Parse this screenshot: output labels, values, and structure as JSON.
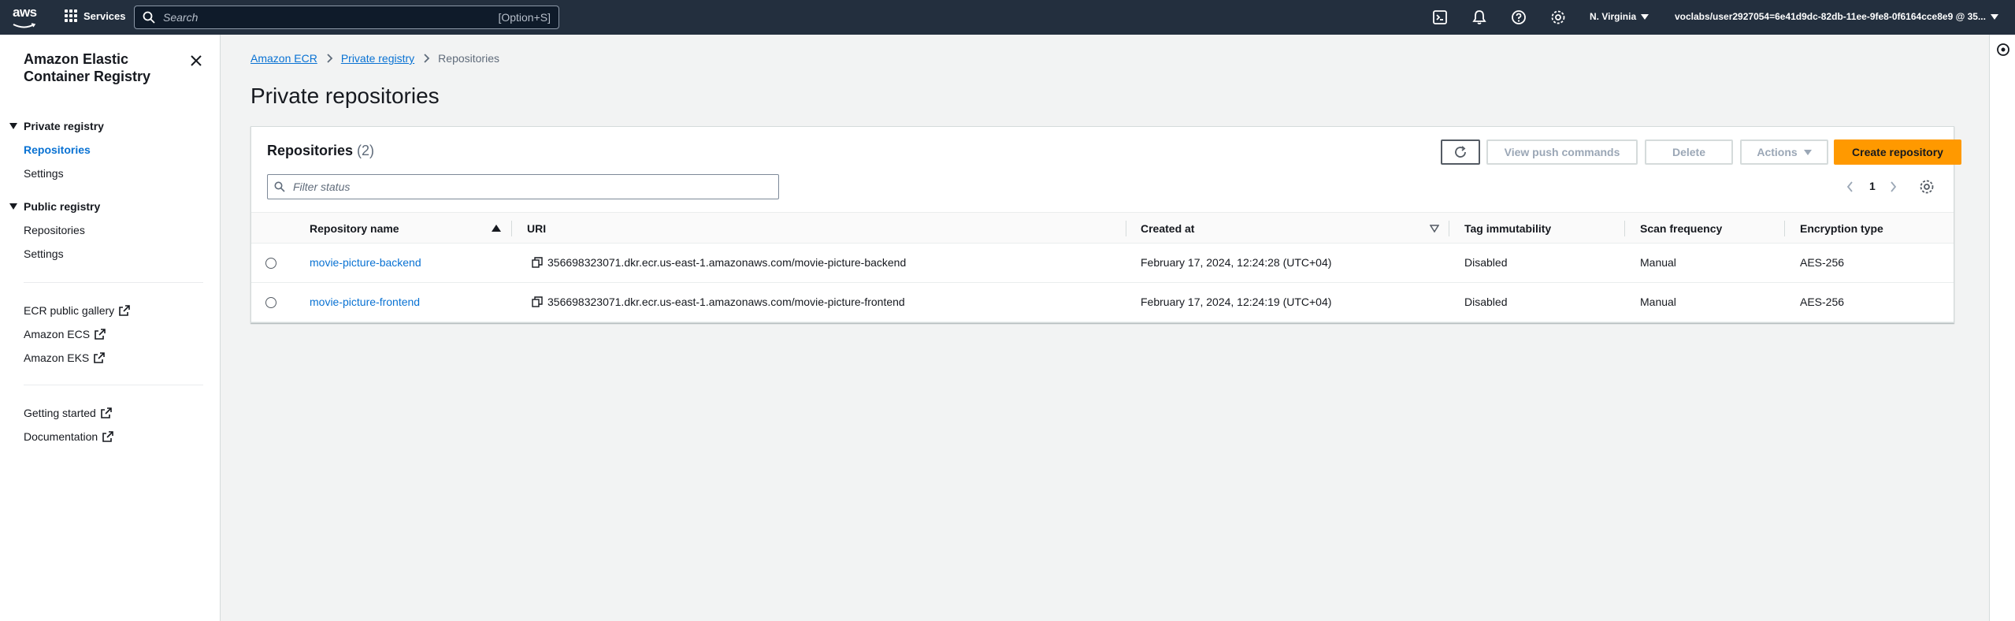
{
  "topnav": {
    "logo_text": "aws",
    "services_label": "Services",
    "search_placeholder": "Search",
    "search_shortcut": "[Option+S]",
    "region": "N. Virginia",
    "account": "voclabs/user2927054=6e41d9dc-82db-11ee-9fe8-0f6164cce8e9 @ 35..."
  },
  "sidebar": {
    "title": "Amazon Elastic Container Registry",
    "private_registry": {
      "label": "Private registry",
      "items": [
        {
          "label": "Repositories",
          "active": true
        },
        {
          "label": "Settings",
          "active": false
        }
      ]
    },
    "public_registry": {
      "label": "Public registry",
      "items": [
        {
          "label": "Repositories"
        },
        {
          "label": "Settings"
        }
      ]
    },
    "external_links": [
      {
        "label": "ECR public gallery"
      },
      {
        "label": "Amazon ECS"
      },
      {
        "label": "Amazon EKS"
      }
    ],
    "help_links": [
      {
        "label": "Getting started"
      },
      {
        "label": "Documentation"
      }
    ]
  },
  "breadcrumb": {
    "items": [
      "Amazon ECR",
      "Private registry",
      "Repositories"
    ]
  },
  "page_title": "Private repositories",
  "panel": {
    "title": "Repositories",
    "count": "(2)",
    "buttons": {
      "view_push": "View push commands",
      "delete": "Delete",
      "actions": "Actions",
      "create": "Create repository"
    },
    "filter_placeholder": "Filter status",
    "page_number": "1"
  },
  "table": {
    "columns": [
      "Repository name",
      "URI",
      "Created at",
      "Tag immutability",
      "Scan frequency",
      "Encryption type"
    ],
    "rows": [
      {
        "name": "movie-picture-backend",
        "uri": "356698323071.dkr.ecr.us-east-1.amazonaws.com/movie-picture-backend",
        "created": "February 17, 2024, 12:24:28 (UTC+04)",
        "tag_immutability": "Disabled",
        "scan_frequency": "Manual",
        "encryption": "AES-256"
      },
      {
        "name": "movie-picture-frontend",
        "uri": "356698323071.dkr.ecr.us-east-1.amazonaws.com/movie-picture-frontend",
        "created": "February 17, 2024, 12:24:19 (UTC+04)",
        "tag_immutability": "Disabled",
        "scan_frequency": "Manual",
        "encryption": "AES-256"
      }
    ]
  },
  "colors": {
    "nav_bg": "#232f3e",
    "link": "#0972d3",
    "primary": "#ff9900"
  }
}
